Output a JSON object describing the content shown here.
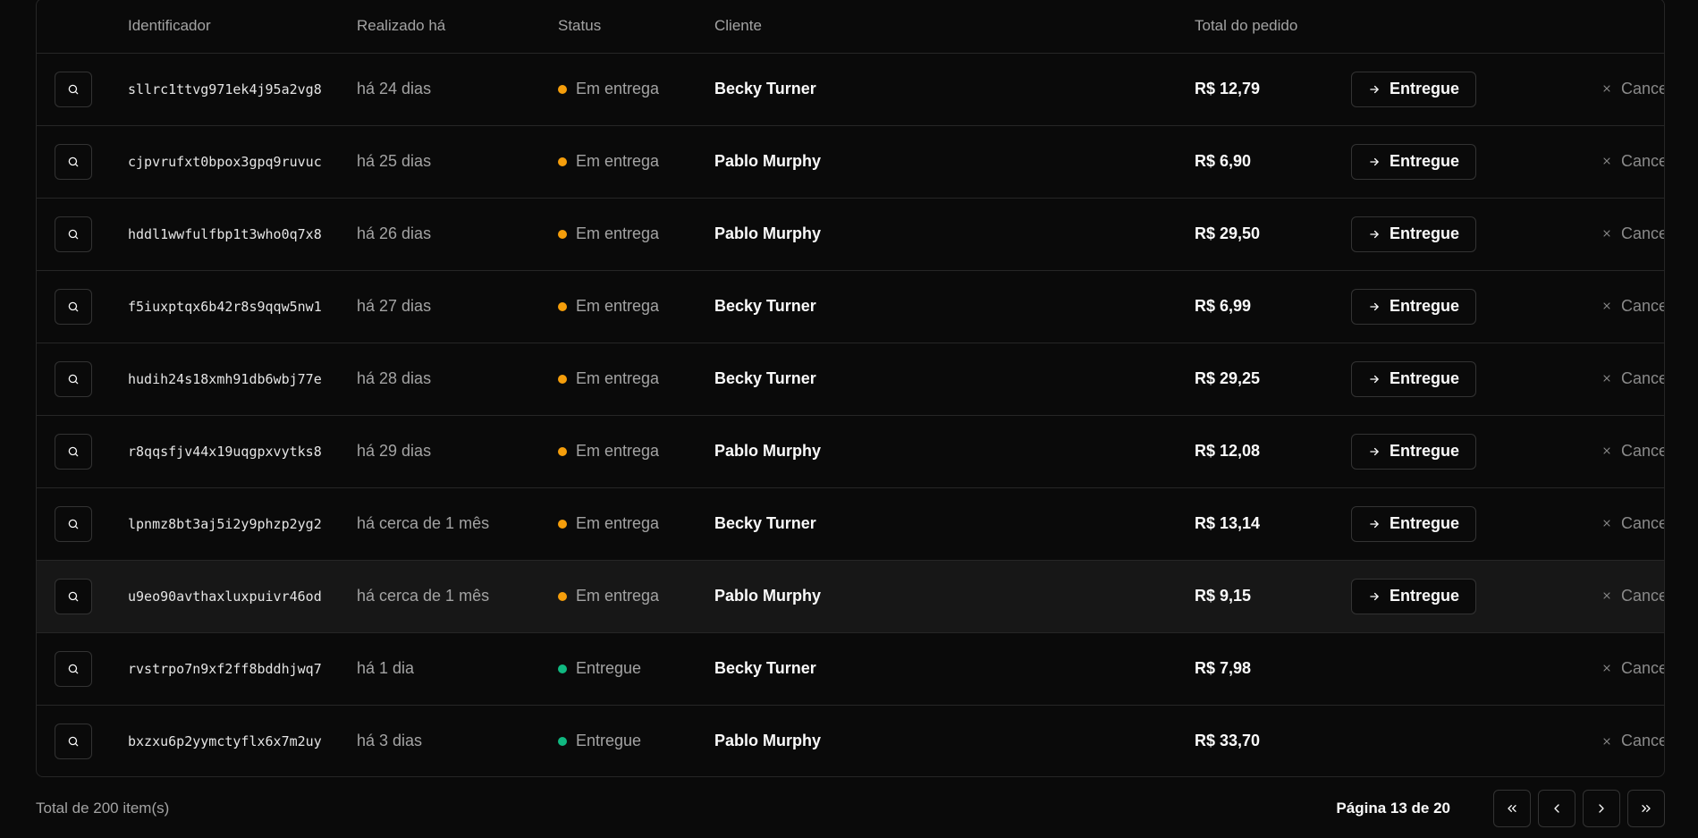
{
  "headers": {
    "id": "Identificador",
    "time": "Realizado há",
    "status": "Status",
    "client": "Cliente",
    "total": "Total do pedido"
  },
  "colors": {
    "pending": "#f59e0b",
    "delivered": "#10b981"
  },
  "actions": {
    "deliver": "Entregue",
    "cancel": "Cancelar"
  },
  "orders": [
    {
      "id": "sllrc1ttvg971ek4j95a2vg8",
      "time": "há 24 dias",
      "status": "Em entrega",
      "client": "Becky Turner",
      "total": "R$ 12,79",
      "deliverable": true
    },
    {
      "id": "cjpvrufxt0bpox3gpq9ruvuc",
      "time": "há 25 dias",
      "status": "Em entrega",
      "client": "Pablo Murphy",
      "total": "R$ 6,90",
      "deliverable": true
    },
    {
      "id": "hddl1wwfulfbp1t3who0q7x8",
      "time": "há 26 dias",
      "status": "Em entrega",
      "client": "Pablo Murphy",
      "total": "R$ 29,50",
      "deliverable": true
    },
    {
      "id": "f5iuxptqx6b42r8s9qqw5nw1",
      "time": "há 27 dias",
      "status": "Em entrega",
      "client": "Becky Turner",
      "total": "R$ 6,99",
      "deliverable": true
    },
    {
      "id": "hudih24s18xmh91db6wbj77e",
      "time": "há 28 dias",
      "status": "Em entrega",
      "client": "Becky Turner",
      "total": "R$ 29,25",
      "deliverable": true
    },
    {
      "id": "r8qqsfjv44x19uqgpxvytks8",
      "time": "há 29 dias",
      "status": "Em entrega",
      "client": "Pablo Murphy",
      "total": "R$ 12,08",
      "deliverable": true
    },
    {
      "id": "lpnmz8bt3aj5i2y9phzp2yg2",
      "time": "há cerca de 1 mês",
      "status": "Em entrega",
      "client": "Becky Turner",
      "total": "R$ 13,14",
      "deliverable": true
    },
    {
      "id": "u9eo90avthaxluxpuivr46od",
      "time": "há cerca de 1 mês",
      "status": "Em entrega",
      "client": "Pablo Murphy",
      "total": "R$ 9,15",
      "deliverable": true
    },
    {
      "id": "rvstrpo7n9xf2ff8bddhjwq7",
      "time": "há 1 dia",
      "status": "Entregue",
      "client": "Becky Turner",
      "total": "R$ 7,98",
      "deliverable": false
    },
    {
      "id": "bxzxu6p2yymctyflx6x7m2uy",
      "time": "há 3 dias",
      "status": "Entregue",
      "client": "Pablo Murphy",
      "total": "R$ 33,70",
      "deliverable": false
    }
  ],
  "footer": {
    "total_items": "Total de 200 item(s)",
    "page_label": "Página 13 de 20"
  }
}
